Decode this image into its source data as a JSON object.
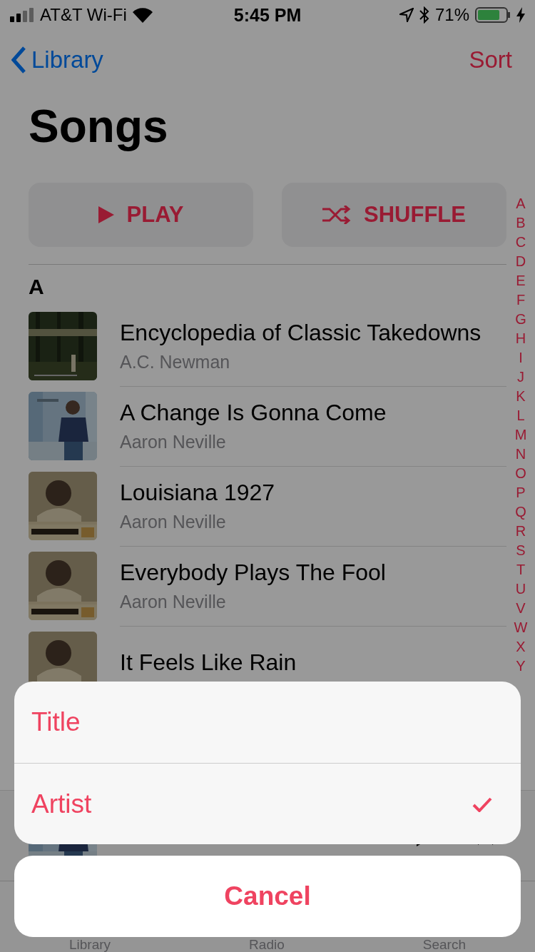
{
  "status_bar": {
    "carrier": "AT&T Wi-Fi",
    "time": "5:45 PM",
    "battery": "71%"
  },
  "nav": {
    "back": "Library",
    "action": "Sort"
  },
  "title": "Songs",
  "buttons": [
    {
      "kind": "play",
      "label": "PLAY"
    },
    {
      "kind": "shuffle",
      "label": "SHUFFLE"
    }
  ],
  "section": "A",
  "songs": [
    {
      "title": "Encyclopedia of Classic Takedowns",
      "artist": "A.C. Newman",
      "art": {
        "kind": "forest"
      }
    },
    {
      "title": "A Change Is Gonna Come",
      "artist": "Aaron Neville",
      "art": {
        "kind": "blue"
      }
    },
    {
      "title": "Louisiana 1927",
      "artist": "Aaron Neville",
      "art": {
        "kind": "sepia"
      }
    },
    {
      "title": "Everybody Plays The Fool",
      "artist": "Aaron Neville",
      "art": {
        "kind": "sepia"
      }
    },
    {
      "title": "It Feels Like Rain",
      "art": {
        "kind": "sepia"
      }
    }
  ],
  "index": [
    "A",
    "B",
    "C",
    "D",
    "E",
    "F",
    "G",
    "H",
    "I",
    "J",
    "K",
    "L",
    "M",
    "N",
    "O",
    "P",
    "Q",
    "R",
    "S",
    "T",
    "U",
    "V",
    "W",
    "X",
    "Y"
  ],
  "tab_bar": [
    "Library",
    "Radio",
    "Search"
  ],
  "action_sheet": {
    "options": [
      {
        "label": "Title",
        "selected": false
      },
      {
        "label": "Artist",
        "selected": true
      }
    ],
    "cancel": "Cancel"
  }
}
